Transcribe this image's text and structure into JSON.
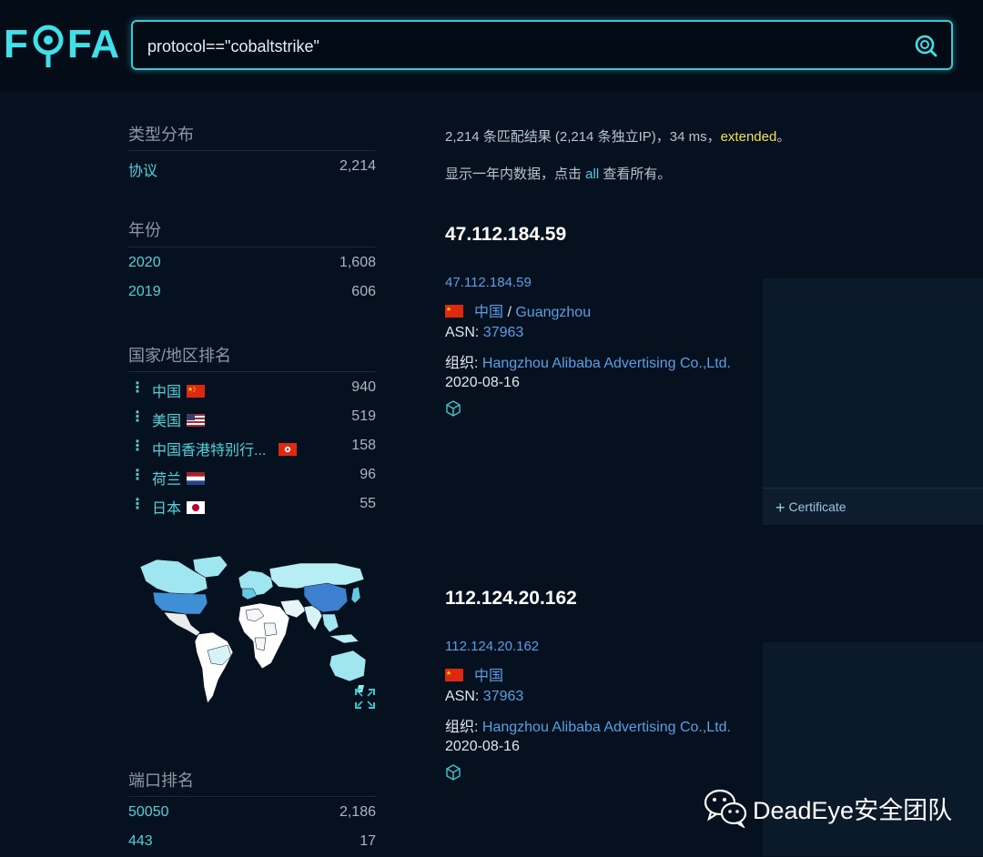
{
  "logo": {
    "text_left": "F",
    "text_right": "FA"
  },
  "search": {
    "value": "protocol==\"cobaltstrike\""
  },
  "sidebar": {
    "type_section": {
      "title": "类型分布",
      "items": [
        {
          "label": "协议",
          "count": "2,214"
        }
      ]
    },
    "year_section": {
      "title": "年份",
      "items": [
        {
          "label": "2020",
          "count": "1,608"
        },
        {
          "label": "2019",
          "count": "606"
        }
      ]
    },
    "country_section": {
      "title": "国家/地区排名",
      "items": [
        {
          "label": "中国",
          "count": "940",
          "flag": "cn-flag"
        },
        {
          "label": "美国",
          "count": "519",
          "flag": "us-flag"
        },
        {
          "label": "中国香港特别行...",
          "count": "158",
          "flag": "hk-flag"
        },
        {
          "label": "荷兰",
          "count": "96",
          "flag": "nl-flag"
        },
        {
          "label": "日本",
          "count": "55",
          "flag": "jp-flag"
        }
      ]
    },
    "port_section": {
      "title": "端口排名",
      "items": [
        {
          "label": "50050",
          "count": "2,186"
        },
        {
          "label": "443",
          "count": "17"
        }
      ]
    }
  },
  "summary": {
    "line1_prefix": "2,214 条匹配结果 (2,214 条独立IP)，34 ms，",
    "line1_extended": "extended",
    "line1_suffix": "。",
    "line2_prefix": "显示一年内数据，点击 ",
    "line2_link": "all",
    "line2_suffix": " 查看所有。"
  },
  "results": [
    {
      "title": "47.112.184.59",
      "link": "47.112.184.59",
      "country": "中国",
      "sep": " / ",
      "city": "Guangzhou",
      "asn_label": "ASN: ",
      "asn": "37963",
      "org_label": "组织: ",
      "org": "Hangzhou Alibaba Advertising Co.,Ltd.",
      "date": "2020-08-16",
      "certificate": "Certificate"
    },
    {
      "title": "112.124.20.162",
      "link": "112.124.20.162",
      "country": "中国",
      "asn_label": "ASN: ",
      "asn": "37963",
      "org_label": "组织: ",
      "org": "Hangzhou Alibaba Advertising Co.,Ltd.",
      "date": "2020-08-16"
    }
  ],
  "watermark": {
    "text": "DeadEye安全团队"
  },
  "colors": {
    "accent": "#3fe0ea",
    "link": "#5a9ee5",
    "highlight": "#f5e14b",
    "background": "#06111f"
  }
}
